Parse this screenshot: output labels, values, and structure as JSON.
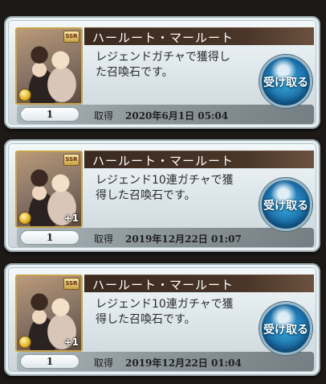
{
  "items": [
    {
      "name": "ハールート・マールート",
      "description": [
        "レジェンドガチャで獲得し",
        "た召喚石です。"
      ],
      "count": "1",
      "acquired_label": "取得",
      "acquired_date": "2020年6月1日 05:04",
      "receive_label": "受け取る",
      "rarity_badge": "SSR",
      "plus_badge": "",
      "element_icon": "light-element-icon"
    },
    {
      "name": "ハールート・マールート",
      "description": [
        "レジェンド10連ガチャで獲",
        "得した召喚石です。"
      ],
      "count": "1",
      "acquired_label": "取得",
      "acquired_date": "2019年12月22日 01:07",
      "receive_label": "受け取る",
      "rarity_badge": "SSR",
      "plus_badge": "+1",
      "element_icon": "light-element-icon"
    },
    {
      "name": "ハールート・マールート",
      "description": [
        "レジェンド10連ガチャで獲",
        "得した召喚石です。"
      ],
      "count": "1",
      "acquired_label": "取得",
      "acquired_date": "2019年12月22日 01:04",
      "receive_label": "受け取る",
      "rarity_badge": "SSR",
      "plus_badge": "+1",
      "element_icon": "light-element-icon"
    }
  ]
}
